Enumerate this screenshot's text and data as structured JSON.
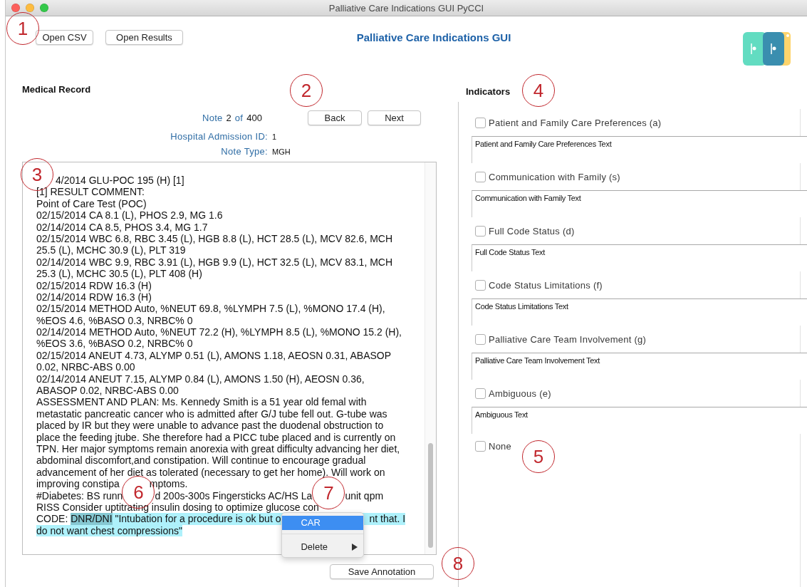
{
  "window": {
    "title": "Palliative Care Indications GUI PyCCI"
  },
  "toolbar": {
    "buttons": [
      "Open CSV",
      "Open Results"
    ],
    "app_title": "Palliative Care Indications GUI"
  },
  "medical_record": {
    "heading": "Medical Record",
    "note": {
      "label": "Note",
      "number": "2",
      "of": "of",
      "total": "400"
    },
    "nav_buttons": [
      "Back",
      "Next"
    ],
    "fields": [
      {
        "label": "Hospital Admission ID:",
        "value": "1"
      },
      {
        "label": "Note Type:",
        "value": "MGH"
      }
    ],
    "lines": [
      [
        "4/2014 GLU-POC 195 (H) [1]"
      ],
      [
        "[1] RESULT COMMENT:"
      ],
      [
        "Point of Care Test (POC)"
      ],
      [
        "02/15/2014 CA 8.1 (L), PHOS 2.9, MG 1.6"
      ],
      [
        "02/14/2014 CA 8.5, PHOS 3.4, MG 1.7"
      ],
      [
        "02/15/2014 WBC 6.8, RBC 3.45 (L), HGB 8.8 (L), HCT 28.5 (L), MCV 82.6, MCH"
      ],
      [
        "25.5 (L), MCHC 30.9 (L), PLT 319"
      ],
      [
        "02/14/2014 WBC 9.9, RBC 3.91 (L), HGB 9.9 (L), HCT 32.5 (L), MCV 83.1, MCH"
      ],
      [
        "25.3 (L), MCHC 30.5 (L), PLT 408 (H)"
      ],
      [
        "02/15/2014 RDW 16.3 (H)"
      ],
      [
        "02/14/2014 RDW 16.3 (H)"
      ],
      [
        "02/15/2014 METHOD Auto, %NEUT 69.8, %LYMPH 7.5 (L), %MONO 17.4 (H),"
      ],
      [
        "%EOS 4.6, %BASO 0.3, NRBC% 0"
      ],
      [
        "02/14/2014 METHOD Auto, %NEUT 72.2 (H), %LYMPH 8.5 (L), %MONO 15.2 (H),"
      ],
      [
        "%EOS 3.6, %BASO 0.2, NRBC% 0"
      ],
      [
        "02/15/2014 ANEUT 4.73, ALYMP 0.51 (L), AMONS 1.18, AEOSN 0.31, ABASOP"
      ],
      [
        "0.02, NRBC-ABS 0.00"
      ],
      [
        "02/14/2014 ANEUT 7.15, ALYMP 0.84 (L), AMONS 1.50 (H), AEOSN 0.36,"
      ],
      [
        "ABASOP 0.02, NRBC-ABS 0.00"
      ],
      [
        "ASSESSMENT AND PLAN: Ms. Kennedy Smith is a 51 year old femal with"
      ],
      [
        "metastatic pancreatic cancer who is admitted after G/J tube fell out. G-tube was"
      ],
      [
        "placed by IR but they were unable to advance past the duodenal obstruction to"
      ],
      [
        "place the feeding jtube. She therefore had a PICC tube placed and is currently on"
      ],
      [
        "TPN. Her major symptoms remain anorexia with great difficulty advancing her diet,"
      ],
      [
        "abdominal discomfort,and constipation. Will continue to encourage gradual"
      ],
      [
        "advancement of her diet as tolerated (necessary to get her home). Will work on"
      ],
      [
        "improving constipa",
        "mptoms."
      ],
      [
        "#Diabetes: BS runn",
        "d 200s-300s Fingersticks AC/HS La",
        "unit qpm"
      ],
      [
        "RISS Consider uptitrating insulin dosing to optimize glucose con"
      ],
      [
        {
          "text": "CODE: ",
          "highlighted": false,
          "entity": false
        },
        {
          "text": "DNR/DNI",
          "highlighted": true,
          "entity": true
        },
        {
          "text": " \"Intubation for a procedure is ok but o",
          "highlighted": true,
          "entity": false
        },
        {
          "text": "nt that. I",
          "highlighted": true,
          "entity": false
        }
      ],
      [
        {
          "text": "do not want chest compressions\"",
          "highlighted": true,
          "entity": false
        }
      ]
    ],
    "context_menu": {
      "items": [
        {
          "label": "CAR",
          "selected": true,
          "submenu": false
        },
        {
          "label": "Delete",
          "selected": false,
          "submenu": true
        }
      ]
    },
    "save_button": "Save Annotation"
  },
  "indicators": {
    "heading": "Indicators",
    "items": [
      {
        "label": "Patient and Family Care Preferences (a)",
        "checked": false,
        "text": "Patient and Family Care Preferences Text"
      },
      {
        "label": "Communication with Family (s)",
        "checked": false,
        "text": "Communication with Family Text"
      },
      {
        "label": "Full Code Status (d)",
        "checked": false,
        "text": "Full Code Status Text"
      },
      {
        "label": "Code Status Limitations (f)",
        "checked": false,
        "text": "Code Status Limitations Text"
      },
      {
        "label": "Palliative Care Team Involvement (g)",
        "checked": false,
        "text": "Palliative Care Team Involvement Text"
      },
      {
        "label": "Ambiguous (e)",
        "checked": false,
        "text": "Ambiguous Text"
      },
      {
        "label": "None",
        "checked": false
      }
    ]
  },
  "callouts": [
    "1",
    "2",
    "3",
    "4",
    "5",
    "6",
    "7",
    "8"
  ]
}
